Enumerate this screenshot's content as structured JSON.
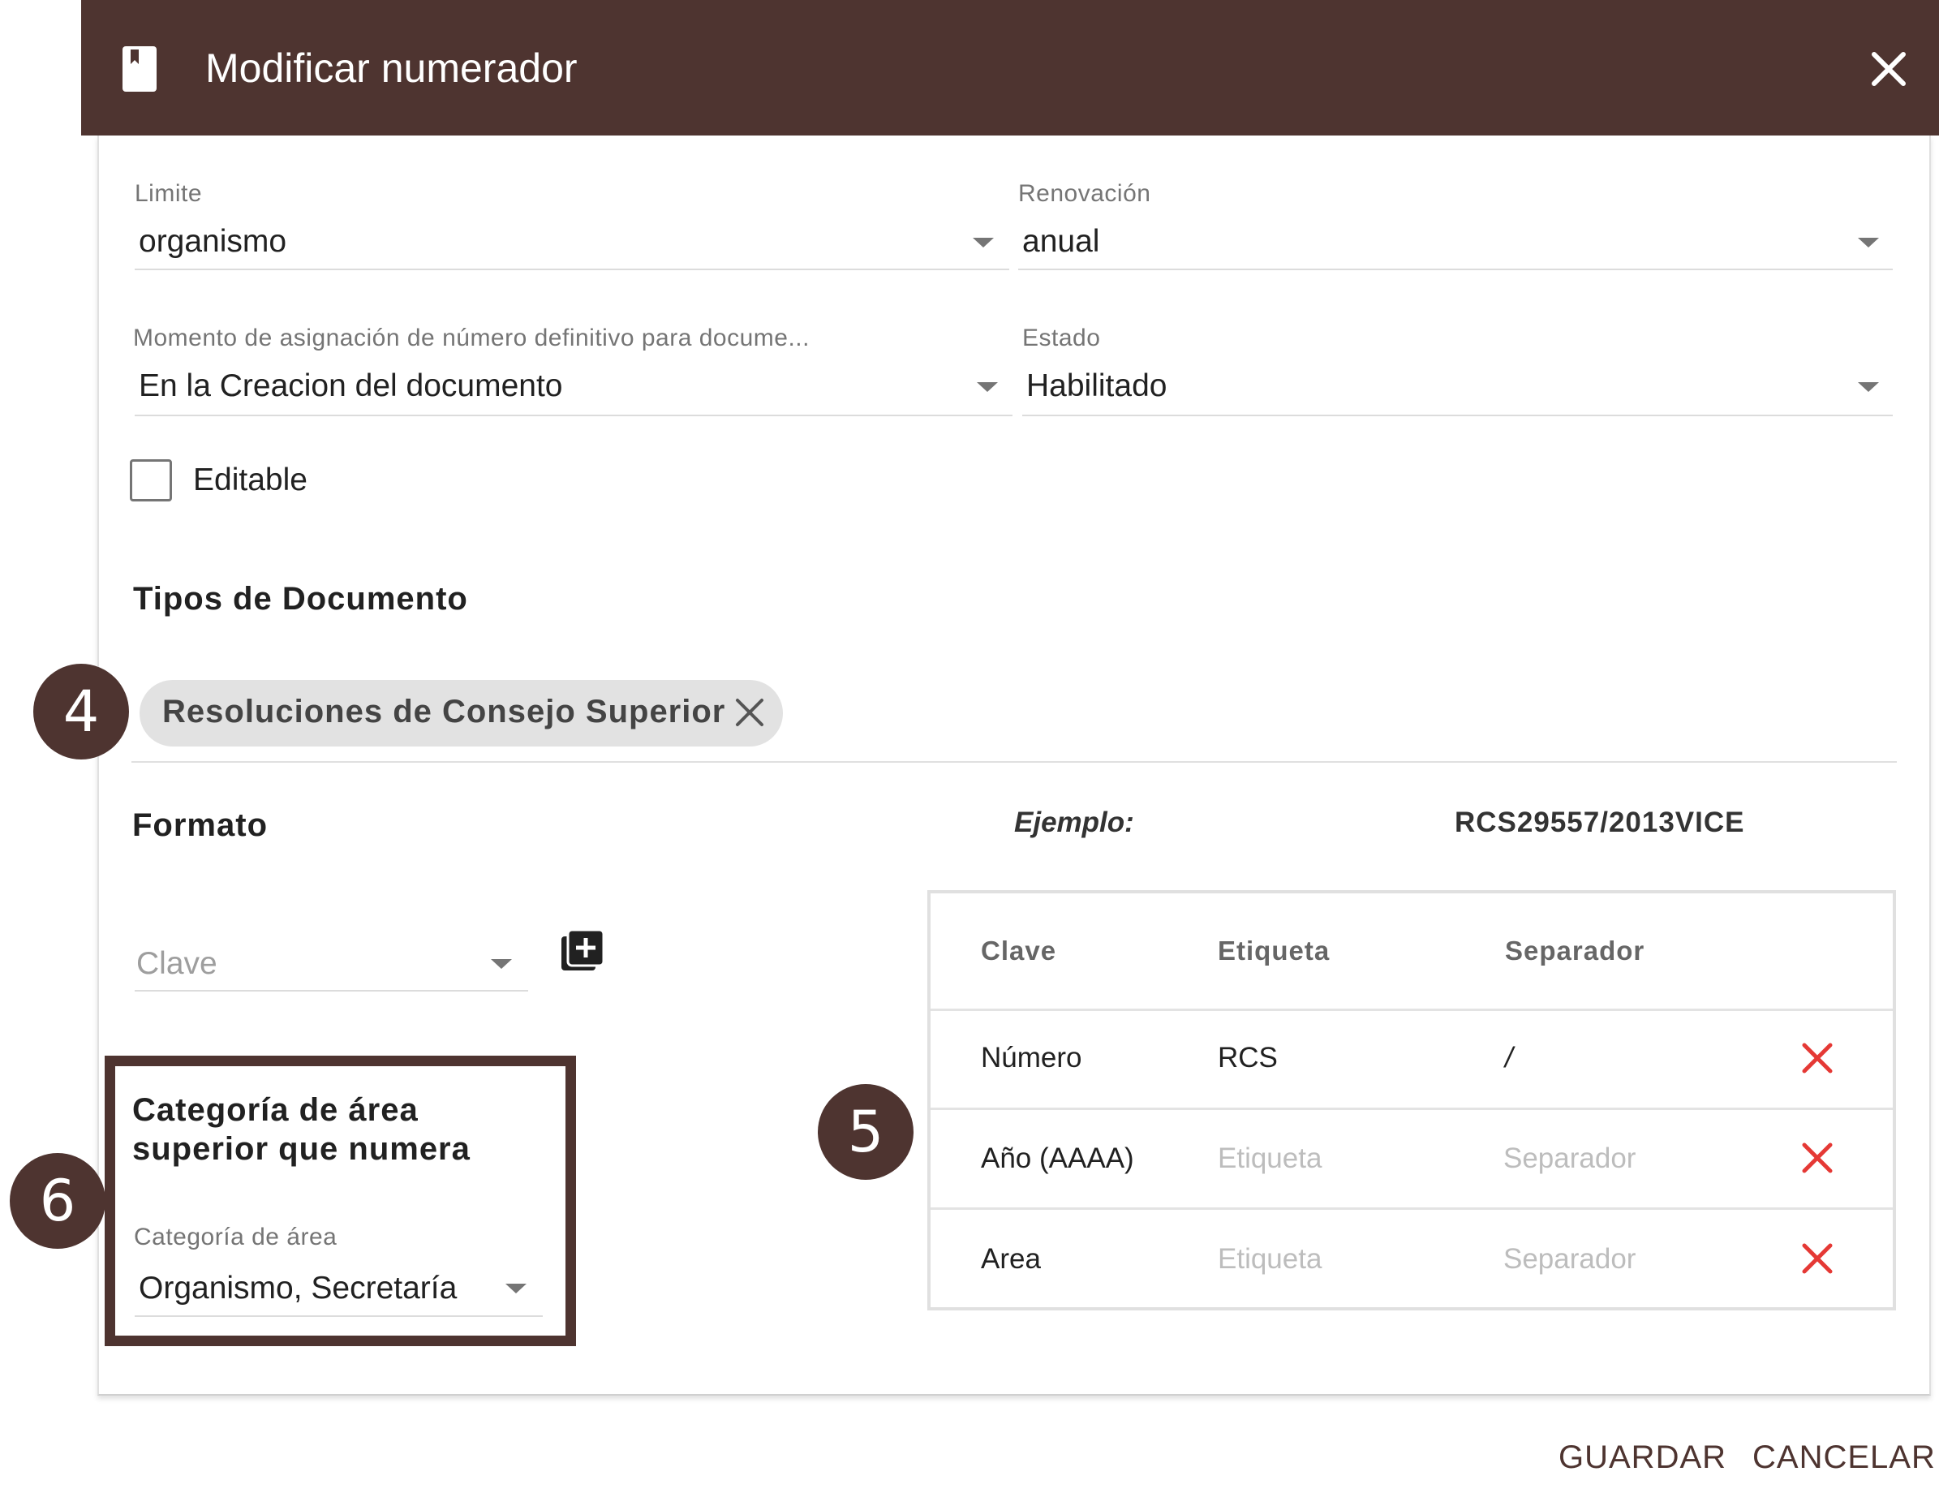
{
  "header": {
    "title": "Modificar numerador",
    "icon": "book-icon",
    "close_icon": "close-icon",
    "background": "#4e3430"
  },
  "fields": {
    "limite": {
      "label": "Limite",
      "value": "organismo"
    },
    "renovacion": {
      "label": "Renovación",
      "value": "anual"
    },
    "momento": {
      "label": "Momento de asignación de número definitivo para docume...",
      "value": "En la Creacion del documento"
    },
    "estado": {
      "label": "Estado",
      "value": "Habilitado"
    }
  },
  "editable": {
    "label": "Editable",
    "checked": false
  },
  "tipos": {
    "title": "Tipos de Documento",
    "chip": "Resoluciones de Consejo Superior"
  },
  "formato": {
    "title": "Formato",
    "example_label": "Ejemplo:",
    "example_value": "RCS29557/2013VICE",
    "clave_placeholder": "Clave"
  },
  "categoria": {
    "title_line1": "Categoría de área",
    "title_line2": "superior que numera",
    "label": "Categoría de área",
    "value": "Organismo, Secretaría"
  },
  "table": {
    "headers": [
      "Clave",
      "Etiqueta",
      "Separador"
    ],
    "rows": [
      {
        "clave": "Número",
        "etiqueta": "RCS",
        "separador": "/"
      },
      {
        "clave": "Año (AAAA)",
        "etiqueta": "Etiqueta",
        "separador": "Separador"
      },
      {
        "clave": "Area",
        "etiqueta": "Etiqueta",
        "separador": "Separador"
      }
    ]
  },
  "badges": {
    "b4": "4",
    "b5": "5",
    "b6": "6"
  },
  "footer": {
    "save": "GUARDAR",
    "cancel": "CANCELAR"
  },
  "colors": {
    "accent": "#4e3430",
    "delete": "#e53935"
  }
}
